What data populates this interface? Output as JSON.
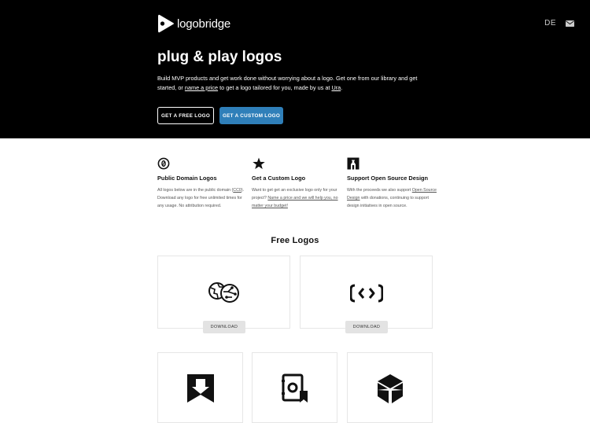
{
  "header": {
    "brand_name": "logobridge",
    "lang": "DE"
  },
  "hero": {
    "headline": "plug & play logos",
    "lead_part1": "Build MVP products and get work done without worrying about a logo. Get one from our library and get started, or ",
    "lead_link1": "name a price",
    "lead_part2": " to get a logo tailored for you, made by us at ",
    "lead_link2": "Ura",
    "lead_part3": ".",
    "btn_free": "GET A FREE LOGO",
    "btn_custom": "GET A CUSTOM LOGO"
  },
  "features": [
    {
      "icon": "zero-circle-icon",
      "title": "Public Domain Logos",
      "desc_a": "All logos below are in the public domain (",
      "desc_link": "CC0",
      "desc_b": "). Download any logo for free unlimited times for any usage. No attribution required."
    },
    {
      "icon": "star-icon",
      "title": "Get a Custom Logo",
      "desc_a": "Want to get get an exclusive logo only for your project? ",
      "desc_link": "Name a price and we will help you, no matter your budget!",
      "desc_b": ""
    },
    {
      "icon": "open-source-icon",
      "title": "Support Open Source Design",
      "desc_a": "With the proceeds we also support ",
      "desc_link": "Open Source Design",
      "desc_b": " with donations, continuing to support design initiatives in open source."
    }
  ],
  "section": {
    "title": "Free Logos"
  },
  "cards": [
    {
      "logo": "globe-pair-logo-icon",
      "download": "DOWNLOAD"
    },
    {
      "logo": "code-brackets-logo-icon",
      "download": "DOWNLOAD"
    },
    {
      "logo": "bookmark-arrow-logo-icon"
    },
    {
      "logo": "safe-bookmark-logo-icon"
    },
    {
      "logo": "hexagon-cube-logo-icon"
    }
  ],
  "colors": {
    "hero_bg": "#000000",
    "accent": "#2f7fb9",
    "download_bg": "#e3e3e3"
  }
}
